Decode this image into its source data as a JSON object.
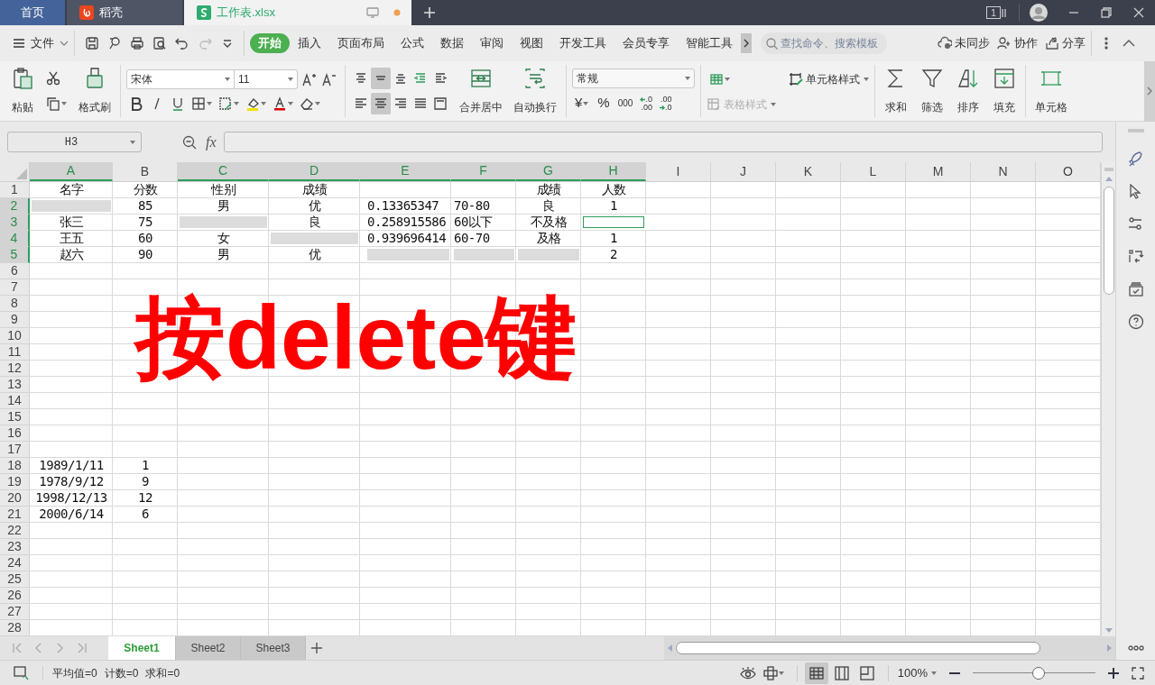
{
  "title_bar": {
    "tabs": [
      {
        "label": "首页",
        "kind": "home",
        "selected": false
      },
      {
        "label": "稻壳",
        "kind": "docer",
        "selected": false
      },
      {
        "label": "工作表.xlsx",
        "kind": "sheet",
        "selected": true
      }
    ],
    "window_count": "1"
  },
  "menu_bar": {
    "file": "文件",
    "tabs": [
      {
        "label": "开始",
        "selected": true
      },
      {
        "label": "插入",
        "selected": false
      },
      {
        "label": "页面布局",
        "selected": false
      },
      {
        "label": "公式",
        "selected": false
      },
      {
        "label": "数据",
        "selected": false
      },
      {
        "label": "审阅",
        "selected": false
      },
      {
        "label": "视图",
        "selected": false
      },
      {
        "label": "开发工具",
        "selected": false
      },
      {
        "label": "会员专享",
        "selected": false
      },
      {
        "label": "智能工具",
        "selected": false
      }
    ],
    "search": {
      "placeholder": "查找命令、搜索模板"
    },
    "actions": [
      "未同步",
      "协作",
      "分享"
    ]
  },
  "ribbon": {
    "paste": "粘贴",
    "format_painter": "格式刷",
    "font": "宋体",
    "font_size": "11",
    "merge_center": "合并居中",
    "wrap_text": "自动换行",
    "number_format": "常规",
    "currency": "¥",
    "percent": "%",
    "thousands": "000",
    "add_decimal": [
      ".0",
      ".00"
    ],
    "remove_decimal": [
      ".00",
      ".0"
    ],
    "cell_style": "单元格样式",
    "table_style": {
      "label": "表格样式",
      "disabled": true
    },
    "sum": "求和",
    "filter": "筛选",
    "sort": "排序",
    "fill": "填充",
    "cells": "单元格"
  },
  "formula_bar": {
    "name_box": "H3",
    "fx": "fx"
  },
  "grid": {
    "columns": [
      {
        "label": "A",
        "selected": true
      },
      {
        "label": "B",
        "selected": false
      },
      {
        "label": "C",
        "selected": true
      },
      {
        "label": "D",
        "selected": true
      },
      {
        "label": "E",
        "selected": true
      },
      {
        "label": "F",
        "selected": true
      },
      {
        "label": "G",
        "selected": true
      },
      {
        "label": "H",
        "selected": true
      },
      {
        "label": "I",
        "selected": false
      },
      {
        "label": "J",
        "selected": false
      },
      {
        "label": "K",
        "selected": false
      },
      {
        "label": "L",
        "selected": false
      },
      {
        "label": "M",
        "selected": false
      },
      {
        "label": "N",
        "selected": false
      },
      {
        "label": "O",
        "selected": false
      }
    ],
    "rows": [
      {
        "label": "1",
        "selected": false,
        "cells": [
          {
            "text": "名字",
            "shaded": false,
            "active": false
          },
          {
            "text": "分数",
            "shaded": false,
            "active": false
          },
          {
            "text": "性别",
            "shaded": false,
            "active": false
          },
          {
            "text": "成绩",
            "shaded": false,
            "active": false
          },
          {},
          {},
          {
            "text": "成绩",
            "shaded": false,
            "active": false
          },
          {
            "text": "人数",
            "shaded": false,
            "active": false
          }
        ]
      },
      {
        "label": "2",
        "selected": true,
        "cells": [
          {
            "shaded": true,
            "active": false
          },
          {
            "text": "85",
            "shaded": false,
            "active": false
          },
          {
            "text": "男",
            "shaded": false,
            "active": false
          },
          {
            "text": "优",
            "shaded": false,
            "active": false
          },
          {
            "text": "0.13365347",
            "shaded": false,
            "active": false
          },
          {
            "text": "70-80",
            "shaded": false,
            "active": false
          },
          {
            "text": "良",
            "shaded": false,
            "active": false
          },
          {
            "text": "1",
            "shaded": false,
            "active": false
          }
        ]
      },
      {
        "label": "3",
        "selected": true,
        "cells": [
          {
            "text": "张三",
            "shaded": false,
            "active": false
          },
          {
            "text": "75",
            "shaded": false,
            "active": false
          },
          {
            "shaded": true,
            "active": false
          },
          {
            "text": "良",
            "shaded": false,
            "active": false
          },
          {
            "text": "0.258915586",
            "shaded": false,
            "active": false
          },
          {
            "text": "60以下",
            "shaded": false,
            "active": false
          },
          {
            "text": "不及格",
            "shaded": false,
            "active": false
          },
          {
            "shaded": false,
            "active": true
          }
        ]
      },
      {
        "label": "4",
        "selected": true,
        "cells": [
          {
            "text": "王五",
            "shaded": false,
            "active": false
          },
          {
            "text": "60",
            "shaded": false,
            "active": false
          },
          {
            "text": "女",
            "shaded": false,
            "active": false
          },
          {
            "shaded": true,
            "active": false
          },
          {
            "text": "0.939696414",
            "shaded": false,
            "active": false
          },
          {
            "text": "60-70",
            "shaded": false,
            "active": false
          },
          {
            "text": "及格",
            "shaded": false,
            "active": false
          },
          {
            "text": "1",
            "shaded": false,
            "active": false
          }
        ]
      },
      {
        "label": "5",
        "selected": true,
        "cells": [
          {
            "text": "赵六",
            "shaded": false,
            "active": false
          },
          {
            "text": "90",
            "shaded": false,
            "active": false
          },
          {
            "text": "男",
            "shaded": false,
            "active": false
          },
          {
            "text": "优",
            "shaded": false,
            "active": false
          },
          {
            "shaded": true,
            "active": false
          },
          {
            "shaded": true,
            "active": false
          },
          {
            "shaded": true,
            "active": false
          },
          {
            "text": "2",
            "shaded": false,
            "active": false
          }
        ]
      },
      {
        "label": "6",
        "selected": false
      },
      {
        "label": "7",
        "selected": false
      },
      {
        "label": "8",
        "selected": false
      },
      {
        "label": "9",
        "selected": false
      },
      {
        "label": "10",
        "selected": false
      },
      {
        "label": "11",
        "selected": false
      },
      {
        "label": "12",
        "selected": false
      },
      {
        "label": "13",
        "selected": false
      },
      {
        "label": "14",
        "selected": false
      },
      {
        "label": "15",
        "selected": false
      },
      {
        "label": "16",
        "selected": false
      },
      {
        "label": "17",
        "selected": false
      },
      {
        "label": "18",
        "selected": false,
        "cells": [
          {
            "text": "1989/1/11",
            "shaded": false,
            "active": false
          },
          {
            "text": "1",
            "shaded": false,
            "active": false
          }
        ]
      },
      {
        "label": "19",
        "selected": false,
        "cells": [
          {
            "text": "1978/9/12",
            "shaded": false,
            "active": false
          },
          {
            "text": "9",
            "shaded": false,
            "active": false
          }
        ]
      },
      {
        "label": "20",
        "selected": false,
        "cells": [
          {
            "text": "1998/12/13",
            "shaded": false,
            "active": false
          },
          {
            "text": "12",
            "shaded": false,
            "active": false
          }
        ]
      },
      {
        "label": "21",
        "selected": false,
        "cells": [
          {
            "text": "2000/6/14",
            "shaded": false,
            "active": false
          },
          {
            "text": "6",
            "shaded": false,
            "active": false
          }
        ]
      },
      {
        "label": "22",
        "selected": false
      },
      {
        "label": "23",
        "selected": false
      },
      {
        "label": "24",
        "selected": false
      },
      {
        "label": "25",
        "selected": false
      },
      {
        "label": "26",
        "selected": false
      },
      {
        "label": "27",
        "selected": false
      },
      {
        "label": "28",
        "selected": false
      }
    ]
  },
  "overlay_caption": "按delete键",
  "sheet_tabs": [
    {
      "label": "Sheet1",
      "selected": true
    },
    {
      "label": "Sheet2",
      "selected": false
    },
    {
      "label": "Sheet3",
      "selected": false
    }
  ],
  "status_bar": {
    "stats": [
      "平均值=0",
      "计数=0",
      "求和=0"
    ],
    "zoom": "100%",
    "zoom_slider": {
      "level": 0.54
    }
  }
}
